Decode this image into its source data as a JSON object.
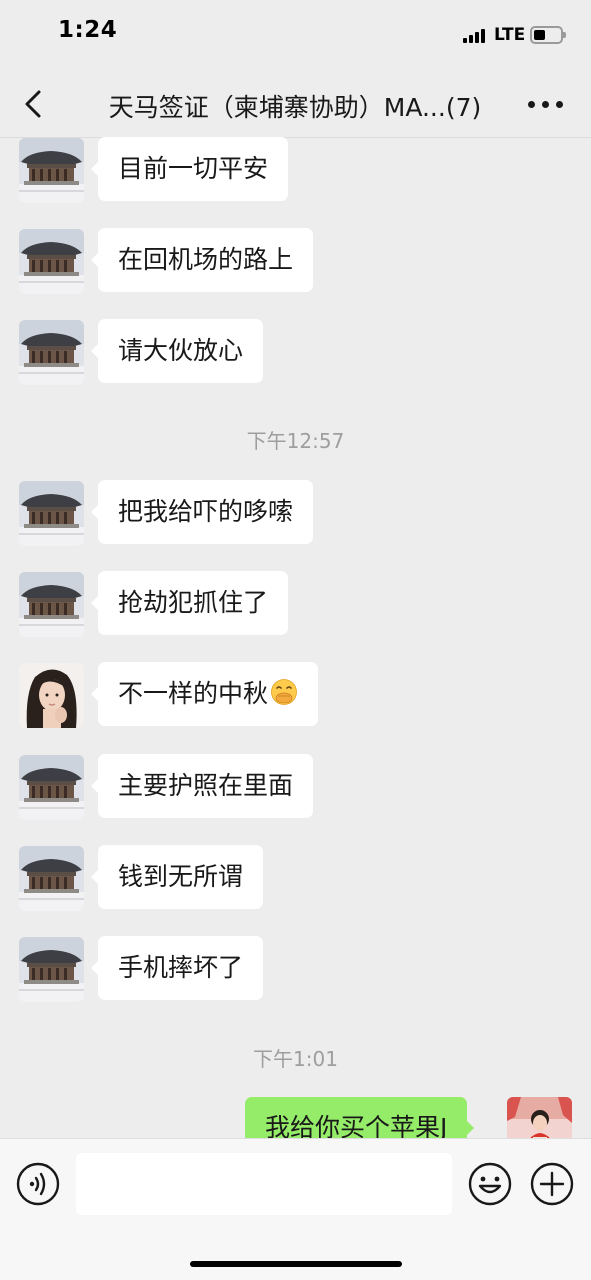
{
  "status_bar": {
    "time": "1:24",
    "network": "LTE"
  },
  "header": {
    "title": "天马签证（柬埔寨协助）MA...(7)",
    "back_icon": "chevron-left-icon",
    "more_icon": "more-dots-icon"
  },
  "messages": [
    {
      "text": "目前一切平安",
      "avatar": "building"
    },
    {
      "text": "在回机场的路上",
      "avatar": "building"
    },
    {
      "text": "请大伙放心",
      "avatar": "building"
    },
    {
      "text": "把我给吓的哆嗦",
      "avatar": "building"
    },
    {
      "text": "抢劫犯抓住了",
      "avatar": "building"
    },
    {
      "text": "不一样的中秋",
      "avatar": "woman",
      "emoji": "hand-over-mouth-emoji"
    },
    {
      "text": "主要护照在里面",
      "avatar": "building"
    },
    {
      "text": "钱到无所谓",
      "avatar": "building"
    },
    {
      "text": "手机摔坏了",
      "avatar": "building"
    }
  ],
  "time_dividers": [
    "下午12:57",
    "下午1:01"
  ],
  "outgoing": {
    "text": "我给你买个苹果J"
  },
  "input_bar": {
    "placeholder": "",
    "voice_icon": "voice-icon",
    "emoji_icon": "smiley-icon",
    "plus_icon": "plus-circle-icon"
  },
  "colors": {
    "background": "#ededed",
    "incoming_bubble": "#ffffff",
    "outgoing_bubble": "#95ec69",
    "timestamp": "#9e9e9e"
  }
}
